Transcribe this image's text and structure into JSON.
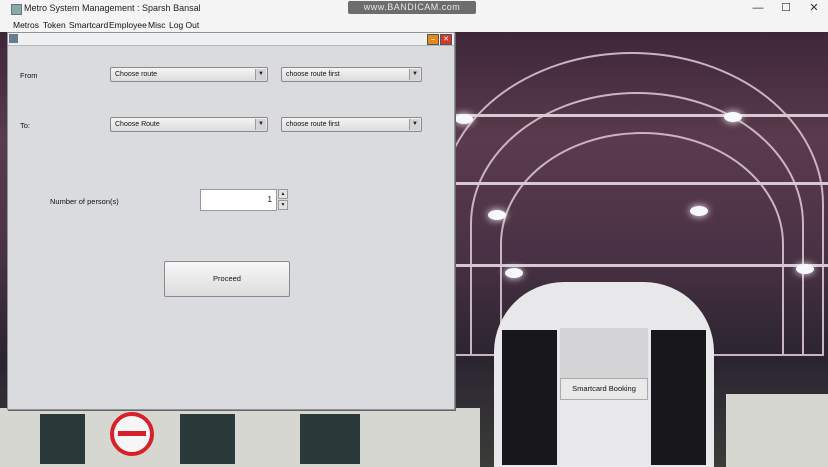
{
  "window": {
    "title": "Metro System Management : Sparsh Bansal",
    "watermark": "www.BANDICAM.com",
    "controls": {
      "minimize": "—",
      "maximize": "☐",
      "close": "✕"
    }
  },
  "menubar": {
    "items": [
      "Metros",
      "Token",
      "Smartcard",
      "Employee",
      "Misc",
      "Log Out"
    ]
  },
  "form": {
    "from_label": "From",
    "from_route": "Choose route",
    "from_station": "choose route first",
    "to_label": "To:",
    "to_route": "Choose Route",
    "to_station": "choose route first",
    "persons_label": "Number of person(s)",
    "persons_value": "1",
    "proceed_label": "Proceed"
  },
  "background": {
    "smartcard_label": "Smartcard Booking"
  },
  "colors": {
    "frame_bg": "#d9dbde",
    "logo_red": "#d8202a"
  }
}
